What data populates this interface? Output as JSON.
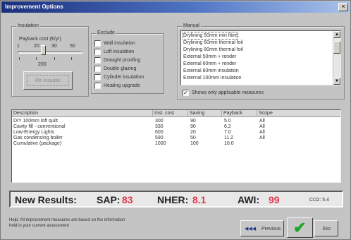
{
  "window": {
    "title": "Improvement Options",
    "close_glyph": "×"
  },
  "insulation": {
    "group_label": "Insulation",
    "slider_label": "Payback cost (€/yr)",
    "ticks": [
      "1",
      "20",
      "30",
      "50"
    ],
    "value_label": "200",
    "value_fraction": 0.4,
    "button_label": "Re-Insulate"
  },
  "exclude": {
    "group_label": "Exclude",
    "items": [
      "Wall insulation",
      "Loft insulation",
      "Draught proofing",
      "Double glazing",
      "Cylinder insulation",
      "Heating upgrade"
    ]
  },
  "manual": {
    "group_label": "Manual",
    "items": [
      "Drylining 50mm min fibre",
      "Drylining 60mm thermal foil",
      "Drylining 80mm thermal foil",
      "External 50mm + render",
      "External 60mm + render",
      "External 80mm insulation",
      "External 100mm insulation"
    ],
    "applicable_label": "Shows only applicable measures",
    "applicable_checked": true
  },
  "table": {
    "headers": [
      "Description",
      "Inst. cost",
      "Saving",
      "Payback",
      "Scope"
    ],
    "rows": [
      [
        "DIY 100mm loft quilt",
        "300",
        "90",
        "5.0",
        "All"
      ],
      [
        "Cavity fill - conventional",
        "330",
        "90",
        "6.2",
        "All"
      ],
      [
        "Low-Energy Lights",
        "600",
        "20",
        "7.0",
        "All"
      ],
      [
        "Gas condensing boiler",
        "590",
        "50",
        "11.2",
        "All"
      ],
      [
        "Cumulative (package)",
        "1000",
        "100",
        "10.0",
        ""
      ]
    ]
  },
  "results": {
    "heading": "New Results:",
    "sap_label": "SAP:",
    "sap_value": "83",
    "nher_label": "NHER:",
    "nher_value": "8.1",
    "awi_label": "AWI:",
    "awi_value": "99",
    "extra": "CO2: 5.4"
  },
  "note": {
    "line1": "Help: All improvement measures are based on the information",
    "line2": "held in your current assessment"
  },
  "buttons": {
    "previous_label": "Previous",
    "previous_arrows": "◀◀◀",
    "ok_glyph": "✔",
    "cancel_label": "Esc"
  },
  "colors": {
    "accent": "#e23a4d",
    "title_start": "#1a2f7c",
    "ok_green": "#1ea52b"
  }
}
